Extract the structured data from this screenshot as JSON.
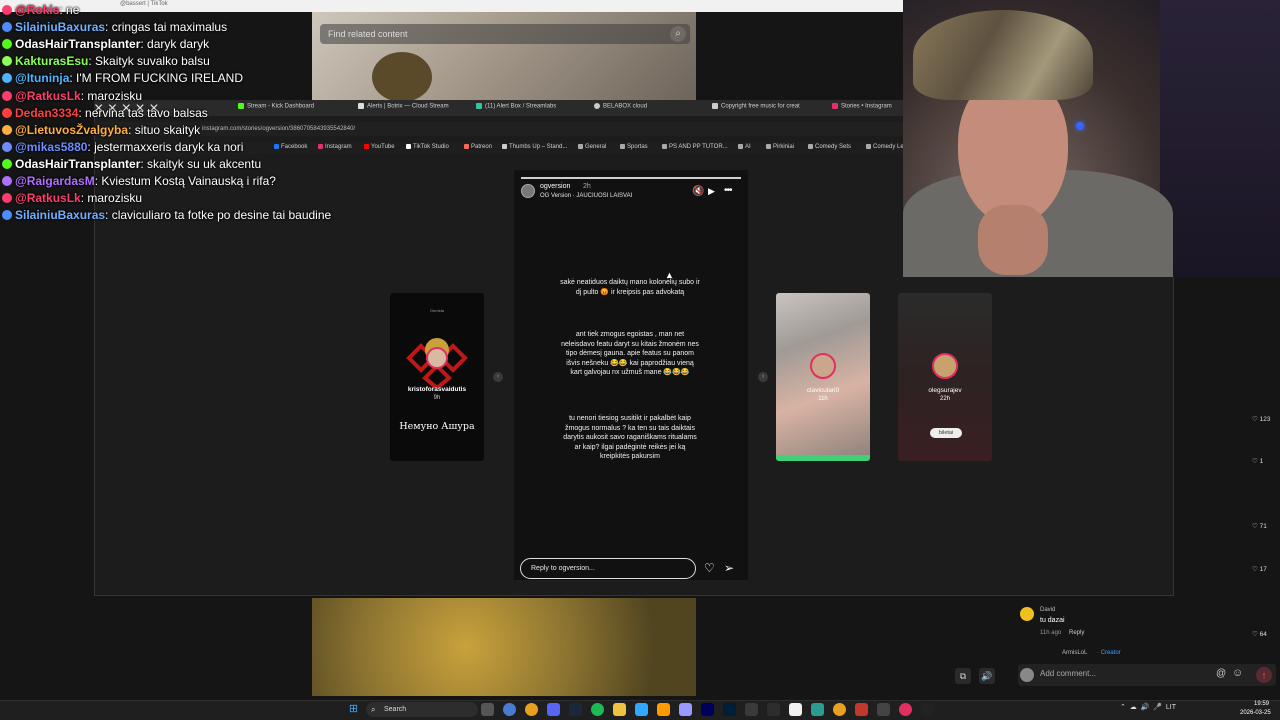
{
  "colors": {
    "kick_green": "#53fc18",
    "tiktok_pink": "#fe2c55",
    "story_ring": "#e03060",
    "creator_blue": "#3aa0ff"
  },
  "background_page": {
    "search_placeholder": "Find related content",
    "top_strip_text": "@bassert | TikTok"
  },
  "chat": {
    "lines": [
      {
        "user": "@Rokis",
        "msg": ": ne",
        "user_color": "#ff3d6e",
        "badge_color": "#ff3d6e"
      },
      {
        "user": "SilainiuBaxuras",
        "msg": ": cringas tai maximalus",
        "user_color": "#6fb0ff",
        "badge_color": "#4f8cff"
      },
      {
        "user": "OdasHairTransplanter",
        "msg": ": daryk daryk",
        "user_color": "#ffffff",
        "badge_color": "#53fc18"
      },
      {
        "user": "KakturasEsu",
        "msg": ": Skaityk suvalko balsu",
        "user_color": "#8dff5a",
        "badge_color": "#8dff5a"
      },
      {
        "user": "@Ituninja",
        "msg": ": I'M FROM FUCKING IRELAND",
        "user_color": "#4fb4ff",
        "badge_color": "#4fb4ff"
      },
      {
        "user": "@RatkusLk",
        "msg": ": marozisku",
        "user_color": "#ff3d6e",
        "badge_color": "#ff3d6e"
      },
      {
        "user": "Dedan3334",
        "msg": ": nervina tas tavo balsas",
        "user_color": "#ff4040",
        "badge_color": "#ff4040"
      },
      {
        "user": "@LietuvosŽvalgyba",
        "msg": ": situo skaityk",
        "user_color": "#ffb040",
        "badge_color": "#ffb040"
      },
      {
        "user": "@mikas5880",
        "msg": ": jestermaxxeris daryk ka nori",
        "user_color": "#6f8cff",
        "badge_color": "#6f8cff"
      },
      {
        "user": "OdasHairTransplanter",
        "msg": ": skaityk su uk akcentu",
        "user_color": "#ffffff",
        "badge_color": "#53fc18"
      },
      {
        "user": "@RaigardasM",
        "msg": ": Kviestum Kostą Vainauską i rifa?",
        "user_color": "#b070ff",
        "badge_color": "#b070ff"
      },
      {
        "user": "@RatkusLk",
        "msg": ": marozisku",
        "user_color": "#ff3d6e",
        "badge_color": "#ff3d6e"
      },
      {
        "user": "SilainiuBaxuras",
        "msg": ": claviculiaro ta fotke po desine tai baudine",
        "user_color": "#6fb0ff",
        "badge_color": "#4f8cff"
      }
    ]
  },
  "browser": {
    "tabs": [
      {
        "label": "Stream - Kick Dashboard",
        "icon_color": "#53fc18"
      },
      {
        "label": "Alerts | Botrix — Cloud Stream",
        "icon_color": "#dddddd"
      },
      {
        "label": "(11) Alert Box / Streamlabs",
        "icon_color": "#31c3a2"
      },
      {
        "label": "BELABOX cloud",
        "icon_color": "#cccccc"
      },
      {
        "label": "Copyright free music for creat",
        "icon_color": "#cccccc"
      },
      {
        "label": "Stories • Instagram",
        "icon_color": "#e1306c"
      }
    ],
    "url": "instagram.com/stories/ogversion/3860705843935542840/",
    "bookmarks": [
      {
        "label": "Facebook",
        "icon_color": "#1877f2"
      },
      {
        "label": "Instagram",
        "icon_color": "#e1306c"
      },
      {
        "label": "YouTube",
        "icon_color": "#ff0000"
      },
      {
        "label": "TikTok Studio",
        "icon_color": "#ffffff"
      },
      {
        "label": "Patreon",
        "icon_color": "#f96854"
      },
      {
        "label": "Thumbs Up – Stand...",
        "icon_color": "#cccccc"
      },
      {
        "label": "General",
        "icon_color": "#cccccc"
      },
      {
        "label": "Sportas",
        "icon_color": "#cccccc"
      },
      {
        "label": "PS AND PP TUTOR...",
        "icon_color": "#cccccc"
      },
      {
        "label": "AI",
        "icon_color": "#cccccc"
      },
      {
        "label": "Pirkiniai",
        "icon_color": "#cccccc"
      },
      {
        "label": "Comedy Sets",
        "icon_color": "#cccccc"
      },
      {
        "label": "Comedy Le",
        "icon_color": "#cccccc"
      }
    ]
  },
  "story": {
    "username": "ogversion",
    "time": "2h",
    "song": "OG Version · JAUCIUOSI LAISVAI",
    "paragraphs": [
      "sakė neatiduos daiktų mano kolonėlių subo ir dj pulto 😡 ir kreipsis pas advokatą",
      "ant tiek zmogus egoistas , man net neleisdavo featu daryt su kitais žmonėm nes tipo dėmesį gauna. apie featus su panom išvis nešneku 😂😂 kai paprodžiau vieną kart galvojau nx užmuš mane 😂😂😂",
      "tu nenori tiesiog susitikt ir pakalbėt kaip žmogus normalus ? ka ten su tais daiktais darytis aukosit savo raganiškams ritualams ar kaip? ilgai padėgintė reikės jei ką kreipkitės pakursim"
    ],
    "reply_placeholder": "Reply to ogversion..."
  },
  "side_stories": {
    "left": {
      "caption": "Gemida",
      "username": "kristoforasvaidutis",
      "time": "9h",
      "overlay": "Немуно Ашура"
    },
    "right1": {
      "username": "claviculari0",
      "time": "11h"
    },
    "right2": {
      "username": "olegsurajev",
      "time": "22h",
      "tag": "biletai"
    }
  },
  "tiktok": {
    "like_counts": [
      "123",
      "1",
      "71",
      "17",
      "64"
    ],
    "comment": {
      "user": "David",
      "text": "tu dazai",
      "meta": "11h ago",
      "reply_label": "Reply"
    },
    "sub_user": "ArmisLoL",
    "sub_badge": "· Creator",
    "add_comment_placeholder": "Add comment..."
  },
  "taskbar": {
    "search_label": "Search",
    "lang": "LIT",
    "time": "19:59",
    "date": "2026-03-25"
  }
}
